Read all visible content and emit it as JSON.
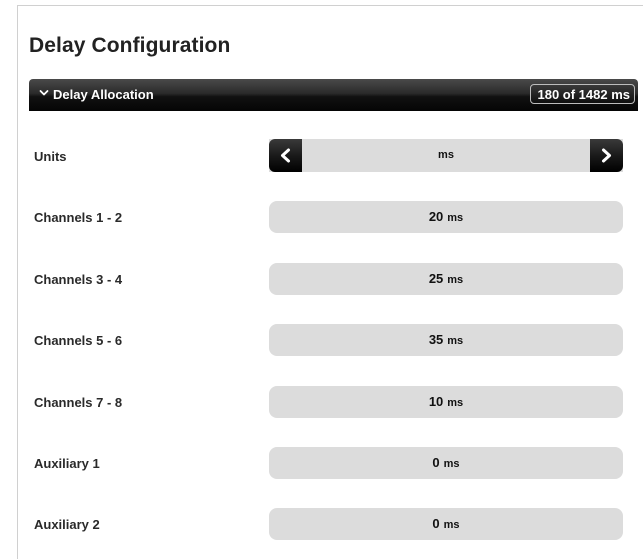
{
  "page": {
    "title": "Delay Configuration"
  },
  "section": {
    "title": "Delay Allocation",
    "allocation": "180 of 1482 ms",
    "chevron_icon": "chevron-down-icon"
  },
  "units": {
    "label": "Units",
    "value": "ms",
    "prev_icon": "chevron-left-icon",
    "next_icon": "chevron-right-icon"
  },
  "rows": [
    {
      "label": "Channels 1 - 2",
      "value": "20",
      "unit": "ms"
    },
    {
      "label": "Channels 3 - 4",
      "value": "25",
      "unit": "ms"
    },
    {
      "label": "Channels 5 - 6",
      "value": "35",
      "unit": "ms"
    },
    {
      "label": "Channels 7 - 8",
      "value": "10",
      "unit": "ms"
    },
    {
      "label": "Auxiliary 1",
      "value": "0",
      "unit": "ms"
    },
    {
      "label": "Auxiliary 2",
      "value": "0",
      "unit": "ms"
    }
  ],
  "colors": {
    "header_bg": "#111111",
    "field_bg": "#dcdcdc",
    "text": "#222222"
  }
}
